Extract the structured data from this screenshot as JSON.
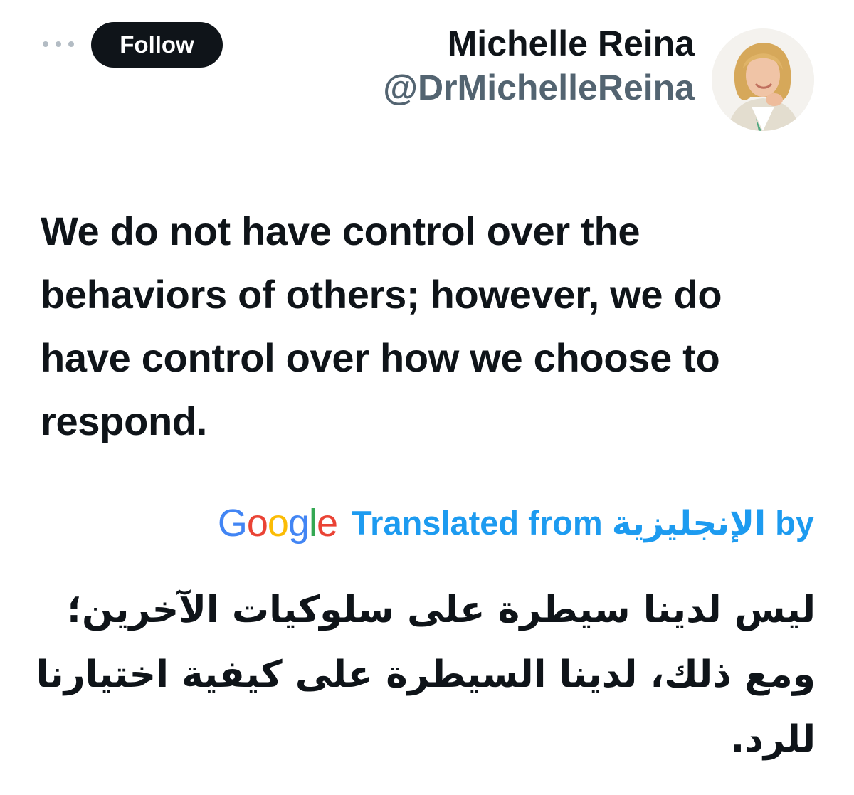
{
  "header": {
    "more_icon": "more-horizontal-icon",
    "follow_label": "Follow",
    "display_name": "Michelle Reina",
    "handle": "@DrMichelleReina",
    "avatar_icon": "profile-avatar"
  },
  "tweet": {
    "text": "We do not have control over the behaviors of others; however, we do have control over how we choose to respond."
  },
  "translation": {
    "logo_text": "Google",
    "label": "Translated from الإنجليزية by",
    "text": "ليس لدينا سيطرة على سلوكيات الآخرين؛ ومع ذلك، لدينا السيطرة على كيفية اختيارنا للرد."
  },
  "colors": {
    "follow_bg": "#0f1419",
    "handle": "#536471",
    "link": "#1d9bf0",
    "google_blue": "#4285f4",
    "google_red": "#ea4335",
    "google_yellow": "#fbbc05",
    "google_green": "#34a853"
  }
}
